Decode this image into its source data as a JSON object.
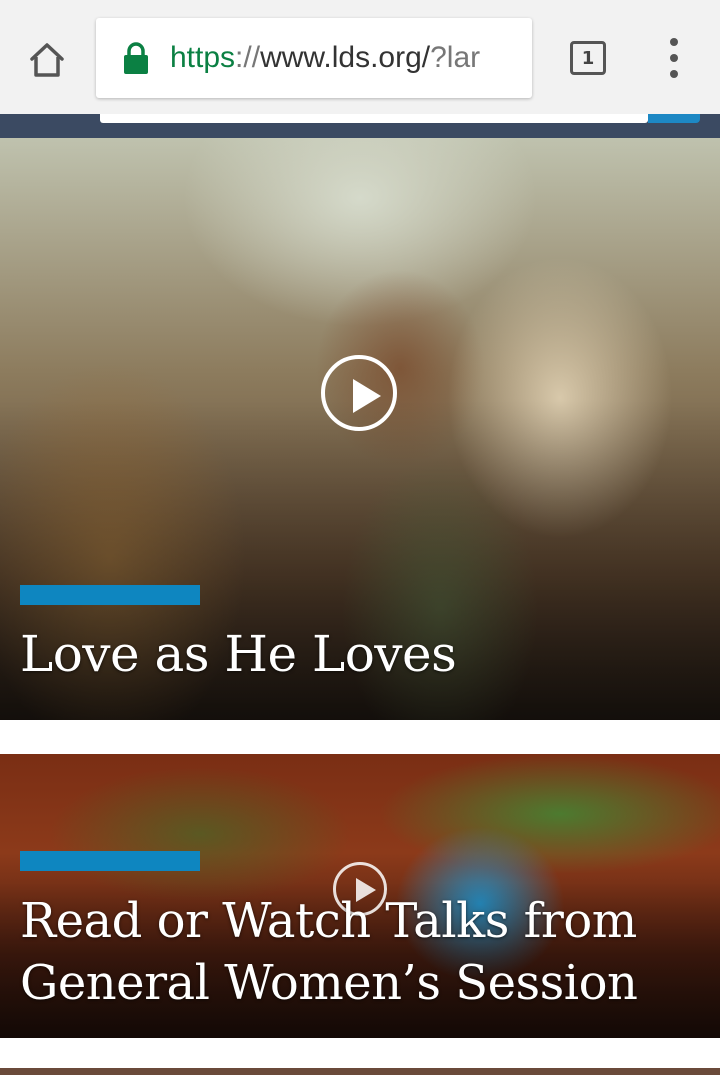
{
  "browser": {
    "url": {
      "scheme": "https",
      "separator": "://",
      "host": "www.lds.org/",
      "rest": "?lar"
    },
    "tab_count": "1"
  },
  "colors": {
    "accent": "#0e86c0",
    "header": "#3b4a62",
    "secure": "#0b8043"
  },
  "icons": {
    "home": "home-icon",
    "lock": "lock-icon",
    "tabs": "tab-switcher-icon",
    "menu": "more-vertical-icon",
    "play": "play-icon"
  },
  "features": [
    {
      "title": "Love as He Loves",
      "media": "video"
    },
    {
      "title": "Read or Watch Talks from General Women’s Session",
      "media": "video"
    }
  ]
}
